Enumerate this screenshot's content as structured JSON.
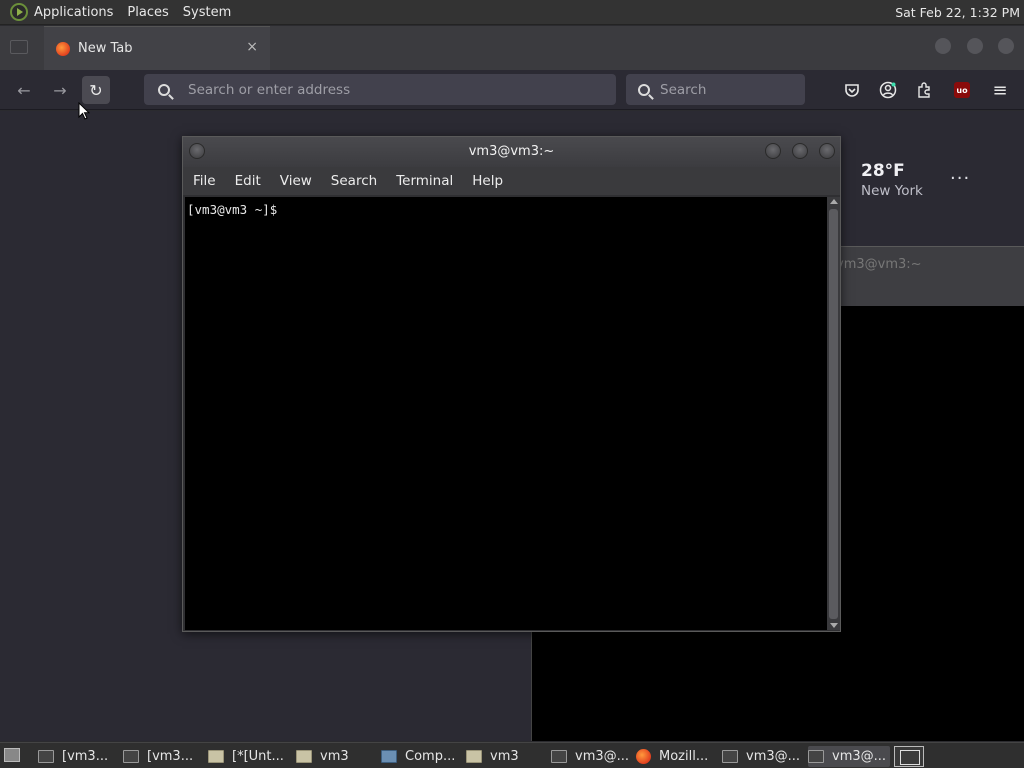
{
  "top_panel": {
    "menus": [
      "Applications",
      "Places",
      "System"
    ],
    "clock": "Sat Feb 22,  1:32 PM"
  },
  "browser": {
    "tab": {
      "title": "New Tab",
      "close": "×"
    },
    "nav": {
      "back": "←",
      "forward": "→",
      "reload": "↻"
    },
    "url_placeholder": "Search or enter address",
    "search_placeholder": "Search",
    "toolbar_icons": [
      "pocket-icon",
      "account-icon",
      "extensions-icon",
      "ublock-icon",
      "menu-icon"
    ],
    "ublock_label": "uo",
    "menu_glyph": "≡",
    "weather": {
      "temp": "28°F",
      "city": "New York",
      "menu": "···"
    }
  },
  "background_terminal": {
    "title": "vm3@vm3:~"
  },
  "terminal": {
    "title": "vm3@vm3:~",
    "menus": [
      "File",
      "Edit",
      "View",
      "Search",
      "Terminal",
      "Help"
    ],
    "prompt": "[vm3@vm3 ~]$"
  },
  "taskbar": {
    "items": [
      {
        "label": "[vm3...",
        "icon": "terminal"
      },
      {
        "label": "[vm3...",
        "icon": "terminal"
      },
      {
        "label": "[*[Unt...",
        "icon": "folder"
      },
      {
        "label": "vm3",
        "icon": "folder"
      },
      {
        "label": "Comp...",
        "icon": "computer"
      },
      {
        "label": "vm3",
        "icon": "folder"
      },
      {
        "label": "vm3@...",
        "icon": "terminal"
      },
      {
        "label": "Mozill...",
        "icon": "firefox"
      },
      {
        "label": "vm3@...",
        "icon": "terminal"
      },
      {
        "label": "vm3@...",
        "icon": "terminal"
      }
    ]
  },
  "colors": {
    "panel": "#333333",
    "browser_bg": "#2b2a33",
    "terminal_bg": "#000000"
  }
}
